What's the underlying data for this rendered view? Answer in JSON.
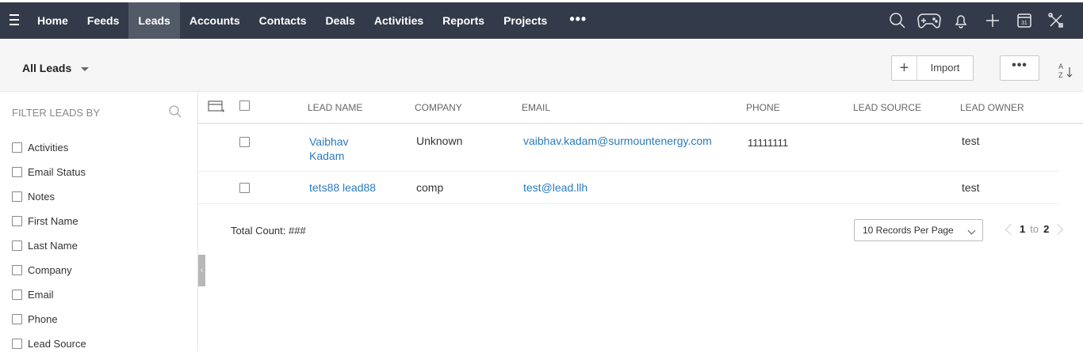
{
  "nav": {
    "items": [
      "Home",
      "Feeds",
      "Leads",
      "Accounts",
      "Contacts",
      "Deals",
      "Activities",
      "Reports",
      "Projects"
    ],
    "active": "Leads",
    "more": "•••"
  },
  "toolbar": {
    "view_label": "All Leads",
    "import_label": "Import",
    "more_label": "•••"
  },
  "sidebar": {
    "title": "FILTER LEADS BY",
    "filters": [
      "Activities",
      "Email Status",
      "Notes",
      "First Name",
      "Last Name",
      "Company",
      "Email",
      "Phone",
      "Lead Source"
    ]
  },
  "table": {
    "columns": [
      "LEAD NAME",
      "COMPANY",
      "EMAIL",
      "PHONE",
      "LEAD SOURCE",
      "LEAD OWNER"
    ],
    "rows": [
      {
        "name_line1": "Vaibhav",
        "name_line2": "Kadam",
        "company": "Unknown",
        "email": "vaibhav.kadam@surmountenergy.com",
        "phone": "11111111",
        "source": "",
        "owner": "test"
      },
      {
        "name_line1": "tets88 lead88",
        "name_line2": "",
        "company": "comp",
        "email": "test@lead.llh",
        "phone": "",
        "source": "",
        "owner": "test"
      }
    ]
  },
  "footer": {
    "total_label": "Total Count: ###",
    "per_page": "10 Records Per Page",
    "page_from": "1",
    "page_to_word": "to",
    "page_to": "2"
  }
}
